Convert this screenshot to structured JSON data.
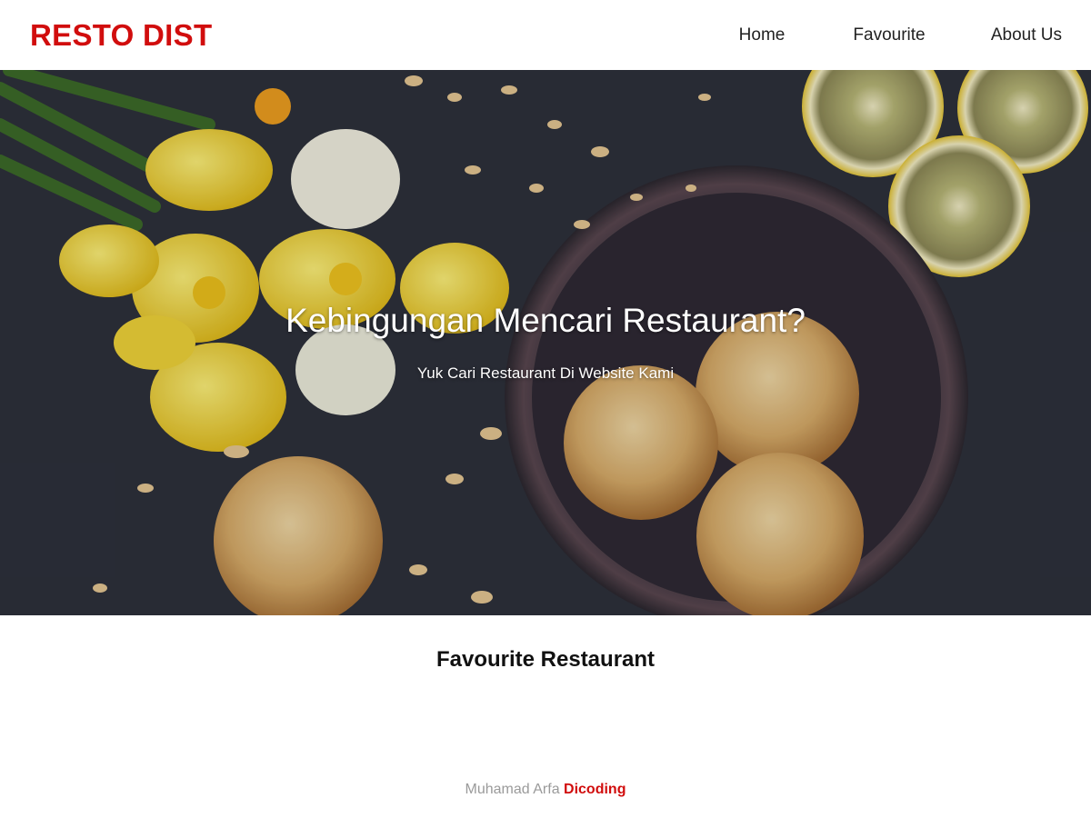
{
  "header": {
    "brand": "RESTO DIST",
    "nav": {
      "home": "Home",
      "favourite": "Favourite",
      "about": "About Us"
    }
  },
  "hero": {
    "title": "Kebingungan Mencari Restaurant?",
    "subtitle": "Yuk Cari Restaurant Di Website Kami"
  },
  "main": {
    "section_title": "Favourite Restaurant"
  },
  "footer": {
    "author": "Muhamad Arfa",
    "link": "Dicoding"
  },
  "colors": {
    "brand": "#d10d0d",
    "hero_background": "#2c2f3a"
  }
}
